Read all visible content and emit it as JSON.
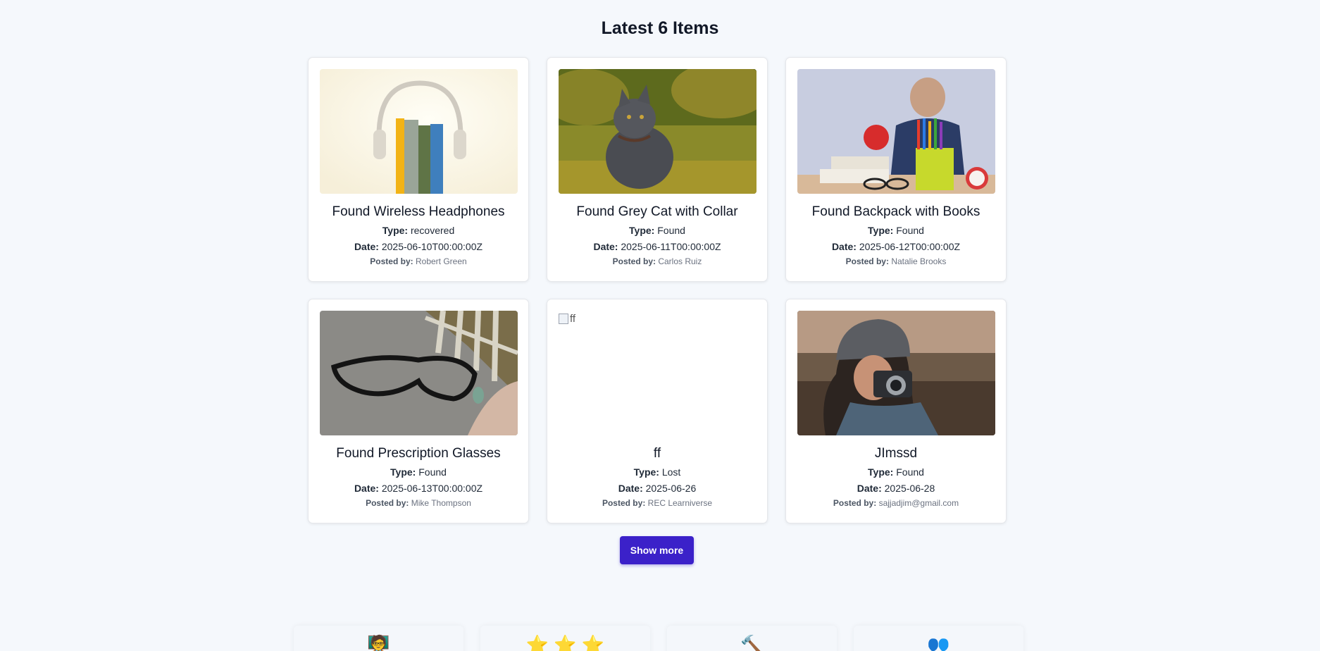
{
  "section": {
    "title": "Latest 6 Items"
  },
  "labels": {
    "type": "Type:",
    "date": "Date:",
    "posted_by": "Posted by:"
  },
  "items": [
    {
      "title": "Found Wireless Headphones",
      "type": "recovered",
      "date": "2025-06-10T00:00:00Z",
      "posted_by": "Robert Green",
      "image": "headphones-books-photo"
    },
    {
      "title": "Found Grey Cat with Collar",
      "type": "Found",
      "date": "2025-06-11T00:00:00Z",
      "posted_by": "Carlos Ruiz",
      "image": "grey-cat-photo"
    },
    {
      "title": "Found Backpack with Books",
      "type": "Found",
      "date": "2025-06-12T00:00:00Z",
      "posted_by": "Natalie Brooks",
      "image": "books-pencils-photo"
    },
    {
      "title": "Found Prescription Glasses",
      "type": "Found",
      "date": "2025-06-13T00:00:00Z",
      "posted_by": "Mike Thompson",
      "image": "glasses-photo"
    },
    {
      "title": "ff",
      "type": "Lost",
      "date": "2025-06-26",
      "posted_by": "REC Learniverse",
      "image_alt": "ff"
    },
    {
      "title": "JImssd",
      "type": "Found",
      "date": "2025-06-28",
      "posted_by": "sajjadjim@gmail.com",
      "image": "photographer-photo"
    }
  ],
  "show_more_label": "Show more",
  "features": [
    {
      "icon": "person-icon",
      "glyph": "🧑‍🏫"
    },
    {
      "icon": "stars-icon",
      "glyph": "⭐ ⭐ ⭐"
    },
    {
      "icon": "hammer-icon",
      "glyph": "🔨"
    },
    {
      "icon": "people-icon",
      "glyph": "👥"
    }
  ]
}
